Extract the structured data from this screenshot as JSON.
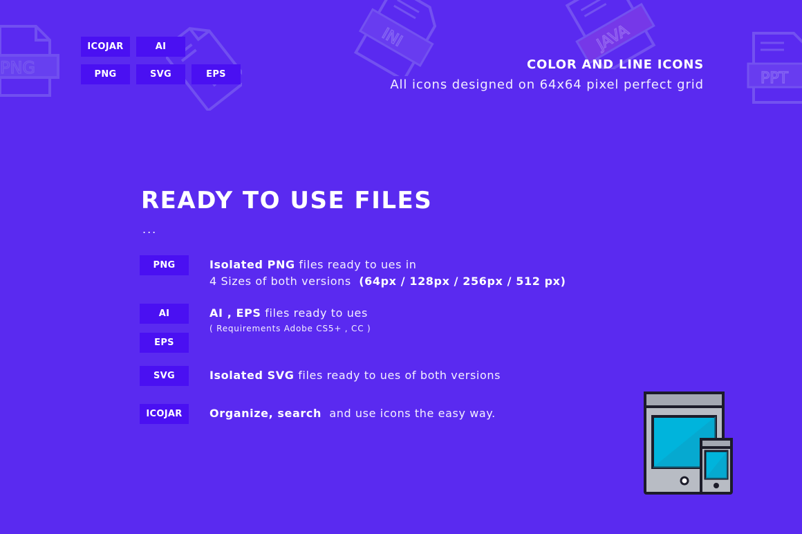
{
  "top_badges": [
    "ICOJAR",
    "AI",
    "PNG",
    "SVG",
    "EPS"
  ],
  "background_icons": [
    "png-file-icon",
    "file-icon",
    "ini-file-icon",
    "java-file-icon",
    "ppt-file-icon"
  ],
  "background_icon_labels": {
    "png": "PNG",
    "ini": "INI",
    "java": "JAVA",
    "ppt": "PPT"
  },
  "header": {
    "heading": "COLOR AND LINE ICONS",
    "subheading": "All icons designed on 64x64 pixel perfect grid"
  },
  "section": {
    "title": "READY TO USE FILES",
    "dots": "...",
    "rows": [
      {
        "badge": "PNG",
        "bold": "Isolated PNG",
        "text": " files ready to ues in",
        "line2": "4 Sizes of both versions  ",
        "line2_bold": "(64px / 128px / 256px / 512 px)"
      },
      {
        "badge": "AI",
        "badge2": "EPS",
        "bold": "AI , EPS",
        "text": " files ready to ues",
        "note": "( Requirements Adobe CS5+ , CC )"
      },
      {
        "badge": "SVG",
        "bold": "Isolated SVG",
        "text": " files ready to ues of both versions"
      },
      {
        "badge": "ICOJAR",
        "bold": "Organize, search",
        "text": "  and use icons the easy way."
      }
    ]
  },
  "illustration": {
    "name": "devices-icon",
    "screen_color": "#00b4dc",
    "body_color": "#b8bcc4",
    "outline_color": "#1c1c2a"
  },
  "colors": {
    "background": "#5a2af0",
    "badge": "#4a10f2",
    "text": "#ffffff"
  }
}
